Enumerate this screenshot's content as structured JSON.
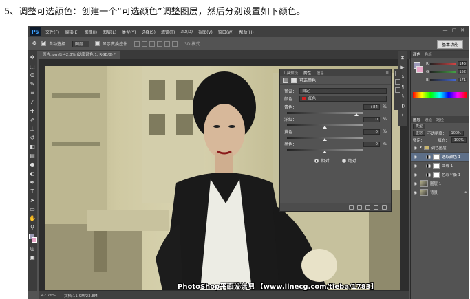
{
  "caption": "5、调整可选颜色：创建一个“可选颜色”调整图层，然后分别设置如下颜色。",
  "app": {
    "logo": "Ps",
    "menu": [
      "文件(F)",
      "编辑(E)",
      "图像(I)",
      "图层(L)",
      "类型(Y)",
      "选择(S)",
      "滤镜(T)",
      "3D(D)",
      "视图(V)",
      "窗口(W)",
      "帮助(H)"
    ],
    "window_controls": [
      "—",
      "▢",
      "✕"
    ]
  },
  "options_bar": {
    "auto_select_label": "自动选择：",
    "auto_select_value": "图层",
    "show_transform_label": "显示变换控件",
    "mode_3d_label": "3D 模式：",
    "workspace": "基本功能"
  },
  "document": {
    "tab_label": "原片.jpg @ 42.8% (选取颜色 1, RGB/8) *",
    "zoom": "42.76%",
    "doc_size": "文档:11.9M/23.8M"
  },
  "properties_panel": {
    "tabs": [
      "工具预设",
      "属性",
      "信息"
    ],
    "active_tab": "属性",
    "title": "可选颜色",
    "preset_label": "预设：",
    "preset_value": "自定",
    "colors_label": "颜色：",
    "colors_value": "红色",
    "sliders": [
      {
        "name": "青色：",
        "value": "+84",
        "fraction": 0.92
      },
      {
        "name": "洋红：",
        "value": "0",
        "fraction": 0.5
      },
      {
        "name": "黄色：",
        "value": "0",
        "fraction": 0.5
      },
      {
        "name": "黑色：",
        "value": "0",
        "fraction": 0.5
      }
    ],
    "percent": "%",
    "methods": [
      {
        "label": "相对",
        "selected": true
      },
      {
        "label": "绝对",
        "selected": false
      }
    ]
  },
  "color_panel": {
    "tabs": [
      "颜色",
      "色板"
    ],
    "channels": [
      {
        "name": "R",
        "value": "145",
        "color": "#d04444"
      },
      {
        "name": "G",
        "value": "152",
        "color": "#44a044"
      },
      {
        "name": "B",
        "value": "171",
        "color": "#4466d0"
      }
    ]
  },
  "layers_panel": {
    "tabs": [
      "图层",
      "通道",
      "路径"
    ],
    "filter_label": "类型",
    "blend_mode": "正常",
    "opacity_label": "不透明度：",
    "opacity": "100%",
    "lock_label": "锁定：",
    "fill_label": "填充：",
    "fill": "100%",
    "layers": [
      {
        "name": "调色图层",
        "type": "group",
        "selected": false
      },
      {
        "name": "选取颜色 1",
        "type": "adjustment",
        "selected": true
      },
      {
        "name": "曲线 1",
        "type": "adjustment",
        "selected": false
      },
      {
        "name": "色彩平衡 1",
        "type": "adjustment",
        "selected": false
      },
      {
        "name": "图层 1",
        "type": "image",
        "selected": false
      },
      {
        "name": "背景",
        "type": "background",
        "selected": false
      }
    ]
  },
  "watermark": "PhotoShop平面设计吧 【www.linecg.com/tieba/1783】"
}
